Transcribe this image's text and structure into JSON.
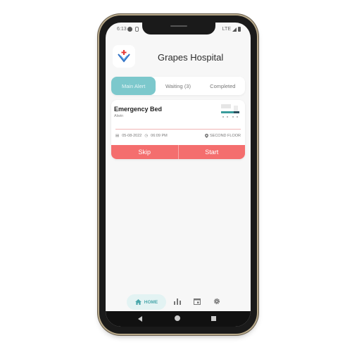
{
  "status_bar": {
    "time": "6:13",
    "network": "LTE"
  },
  "header": {
    "title": "Grapes Hospital"
  },
  "tabs": [
    {
      "label": "Main Alert",
      "active": true
    },
    {
      "label": "Waiting (3)",
      "active": false
    },
    {
      "label": "Completed",
      "active": false
    }
  ],
  "alert": {
    "title": "Emergency Bed",
    "requester": "Alwin",
    "date": "05-08-2022",
    "time": "06:09 PM",
    "location": "SECOND FLOOR",
    "skip_label": "Skip",
    "start_label": "Start"
  },
  "bottom_nav": {
    "home_label": "HOME",
    "items": [
      "home-icon",
      "chart-icon",
      "calendar-icon",
      "settings-icon"
    ]
  },
  "colors": {
    "accent": "#7cc8cc",
    "action": "#f46e6e",
    "home_pill": "#e3f3f3"
  }
}
